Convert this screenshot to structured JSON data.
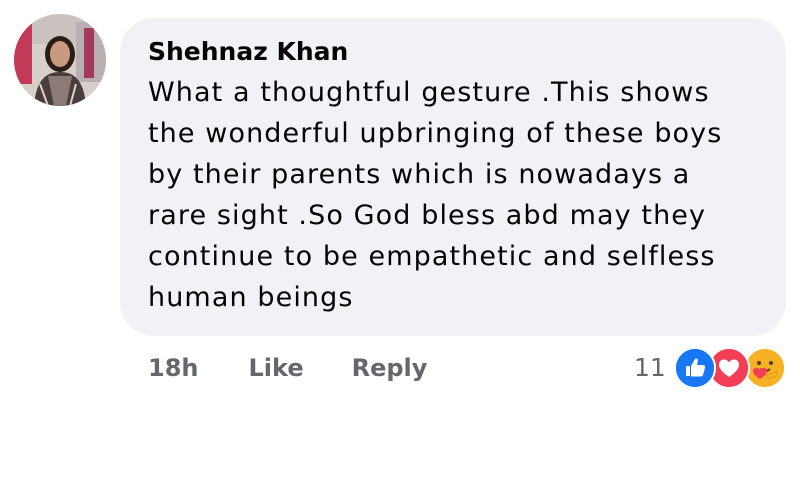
{
  "comment": {
    "author": "Shehnaz Khan",
    "text": "What a thoughtful gesture .This shows\nthe wonderful upbringing of these boys\nby their parents which is nowadays a\nrare sight .So God bless abd may they\ncontinue to be empathetic and selfless\nhuman beings",
    "time": "18h",
    "like_label": "Like",
    "reply_label": "Reply",
    "reaction_count": "11",
    "reactions": [
      "like-icon",
      "love-icon",
      "care-icon"
    ]
  },
  "colors": {
    "bubble": "#f0f2f5",
    "text": "#050505",
    "secondary_text": "#65676b",
    "like_blue": "#1877f2",
    "love_red": "#f33e58",
    "care_yellow": "#f7b125"
  }
}
